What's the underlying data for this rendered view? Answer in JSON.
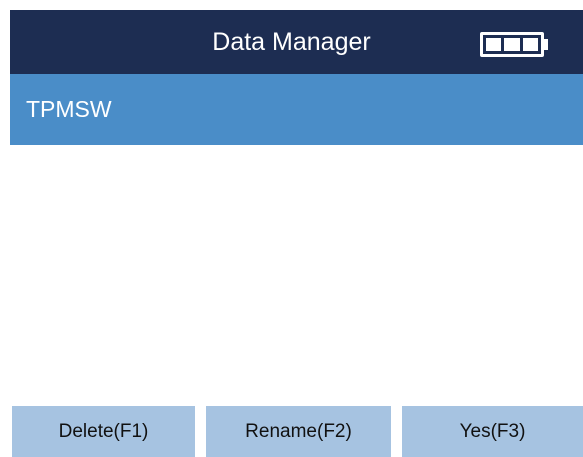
{
  "header": {
    "title": "Data Manager",
    "battery_icon": "battery-full-icon",
    "battery_level": 1.0,
    "background_color": "#1d2d52"
  },
  "folder": {
    "name": "TPMSW",
    "background_color": "#4a8dc8"
  },
  "softkeys": [
    {
      "label": "Delete(F1)"
    },
    {
      "label": "Rename(F2)"
    },
    {
      "label": "Yes(F3)"
    }
  ],
  "softkey_color": "#a6c3e1"
}
